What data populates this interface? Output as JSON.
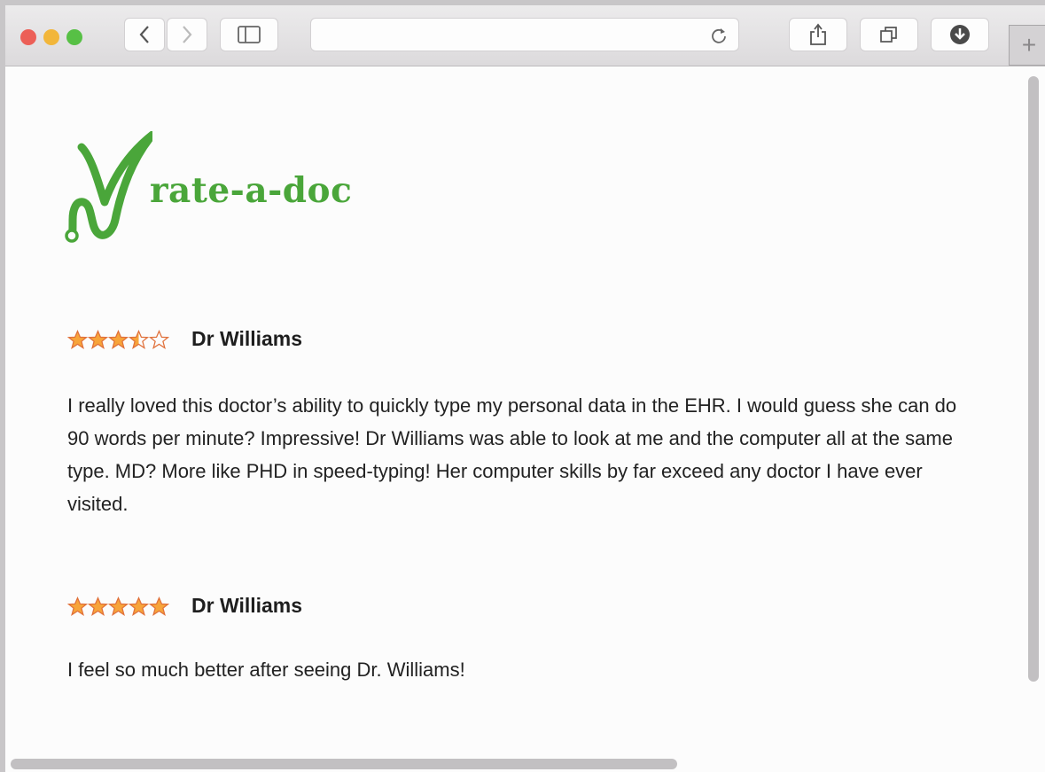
{
  "browser": {
    "traffic_lights": {
      "close": "#ec5f57",
      "minimize": "#f2b63a",
      "zoom": "#57c045"
    },
    "buttons": [
      "back-icon",
      "forward-icon",
      "sidebar-icon",
      "share-icon",
      "tabs-overview-icon",
      "downloads-icon",
      "reload-icon",
      "new-tab-icon"
    ],
    "address_value": "",
    "new_tab_label": "+"
  },
  "site": {
    "logo_text": "rate-a-doc",
    "brand_color": "#4aa63a"
  },
  "reviews": [
    {
      "rating": 3.5,
      "rating_max": 5,
      "doctor": "Dr Williams",
      "text": "I really loved this doctor’s ability to quickly type my personal data in the EHR. I would guess she can do 90 words per minute? Impressive! Dr Williams was able to look at me and the computer all at the same type. MD? More like PHD in speed-typing! Her computer skills by far exceed any doctor I have ever visited."
    },
    {
      "rating": 5,
      "rating_max": 5,
      "doctor": "Dr Williams",
      "text": "I feel so much better after seeing Dr. Williams!"
    }
  ],
  "scrollbars": {
    "vertical_position": 0,
    "horizontal_position": 0
  }
}
